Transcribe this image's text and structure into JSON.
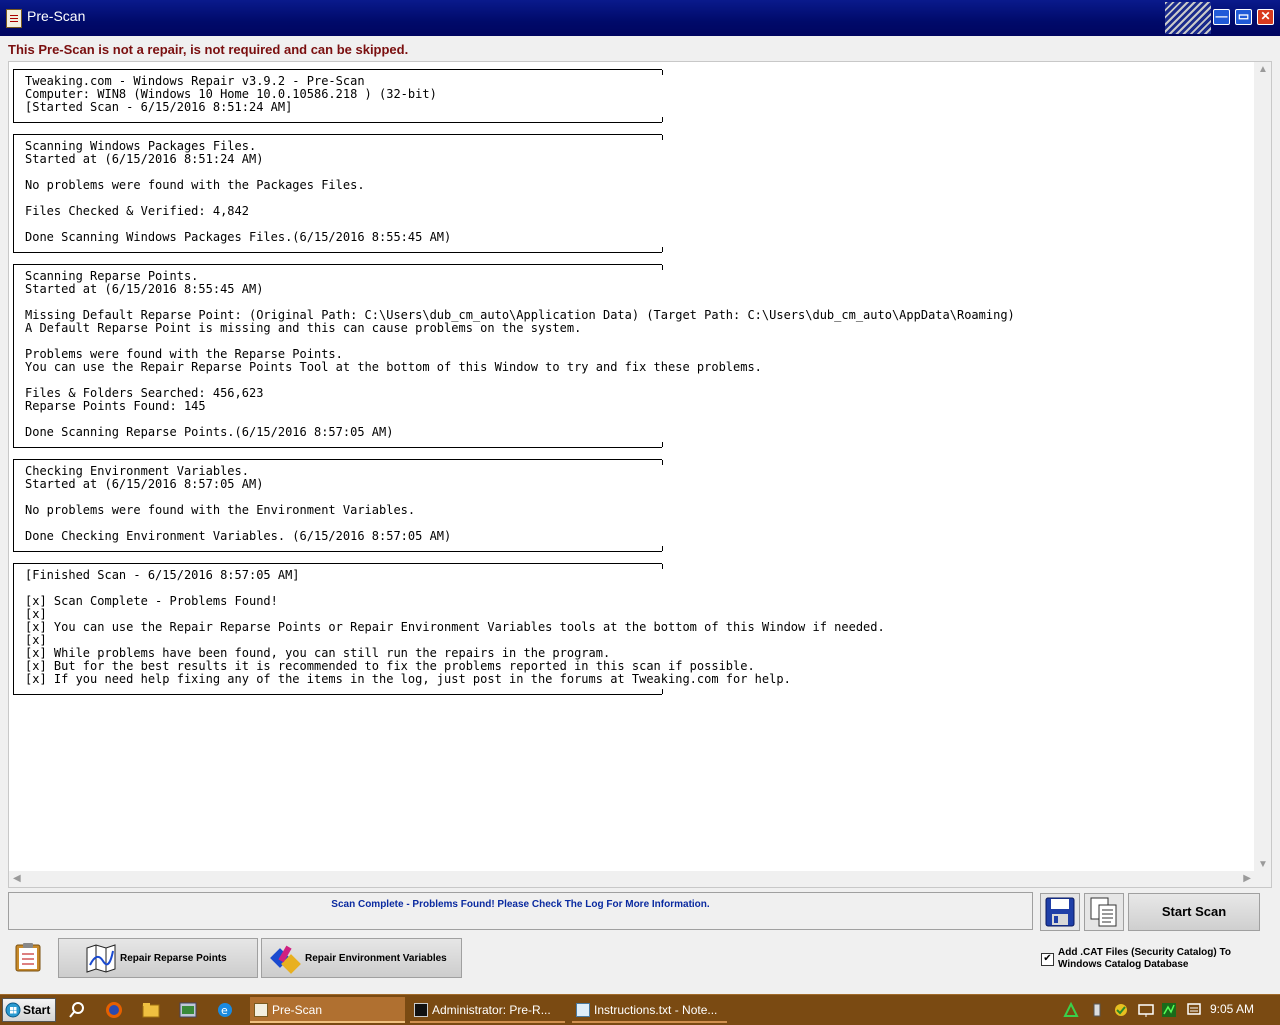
{
  "window": {
    "title": "Pre-Scan",
    "buttons": {
      "minimize": "—",
      "maximize": "▭",
      "close": "✕"
    }
  },
  "warning": "This Pre-Scan is not a repair, is not required and can be skipped.",
  "log": {
    "blocks": [
      "Tweaking.com - Windows Repair v3.9.2 - Pre-Scan\nComputer: WIN8 (Windows 10 Home 10.0.10586.218 ) (32-bit)\n[Started Scan - 6/15/2016 8:51:24 AM]",
      "Scanning Windows Packages Files.\nStarted at (6/15/2016 8:51:24 AM)\n\nNo problems were found with the Packages Files.\n\nFiles Checked & Verified: 4,842\n\nDone Scanning Windows Packages Files.(6/15/2016 8:55:45 AM)",
      "Scanning Reparse Points.\nStarted at (6/15/2016 8:55:45 AM)\n\nMissing Default Reparse Point: (Original Path: C:\\Users\\dub_cm_auto\\Application Data) (Target Path: C:\\Users\\dub_cm_auto\\AppData\\Roaming)\nA Default Reparse Point is missing and this can cause problems on the system.\n\nProblems were found with the Reparse Points.\nYou can use the Repair Reparse Points Tool at the bottom of this Window to try and fix these problems.\n\nFiles & Folders Searched: 456,623\nReparse Points Found: 145\n\nDone Scanning Reparse Points.(6/15/2016 8:57:05 AM)",
      "Checking Environment Variables.\nStarted at (6/15/2016 8:57:05 AM)\n\nNo problems were found with the Environment Variables.\n\nDone Checking Environment Variables. (6/15/2016 8:57:05 AM)",
      "[Finished Scan - 6/15/2016 8:57:05 AM]\n\n[x] Scan Complete - Problems Found!\n[x]\n[x] You can use the Repair Reparse Points or Repair Environment Variables tools at the bottom of this Window if needed.\n[x]\n[x] While problems have been found, you can still run the repairs in the program.\n[x] But for the best results it is recommended to fix the problems reported in this scan if possible.\n[x] If you need help fixing any of the items in the log, just post in the forums at Tweaking.com for help."
    ]
  },
  "status": "Scan Complete - Problems Found! Please Check The Log For More Information.",
  "buttons": {
    "start_scan": "Start Scan",
    "repair_reparse_points": "Repair Reparse Points",
    "repair_environment_variables": "Repair Environment Variables"
  },
  "cat_option": {
    "checked": true,
    "check_glyph": "✔",
    "line1": "Add .CAT Files (Security Catalog) To",
    "line2": "Windows Catalog Database"
  },
  "taskbar": {
    "start": "Start",
    "tasks": [
      "Pre-Scan",
      "Administrator:  Pre-R...",
      "Instructions.txt - Note..."
    ],
    "clock": "9:05 AM"
  },
  "colors": {
    "titlebar": "#000a6a",
    "warning": "#7a0f0f",
    "status_text": "#0a2aa0",
    "taskbar": "#7a4a12"
  }
}
